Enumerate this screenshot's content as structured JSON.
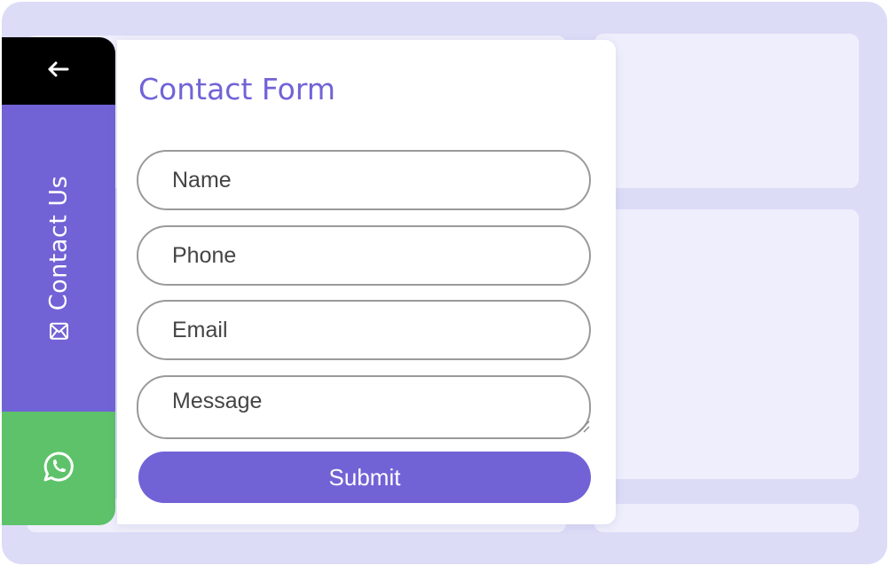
{
  "colors": {
    "accent": "#7163d6",
    "whatsapp": "#5ec26a",
    "back_bar": "#000000",
    "background": "#dcdcf7"
  },
  "sidetab": {
    "back_icon": "arrow-left-icon",
    "contact_label": "Contact Us",
    "contact_icon": "mail-icon",
    "whatsapp_icon": "whatsapp-icon"
  },
  "form": {
    "title": "Contact Form",
    "fields": {
      "name_placeholder": "Name",
      "phone_placeholder": "Phone",
      "email_placeholder": "Email",
      "message_placeholder": "Message"
    },
    "submit_label": "Submit"
  }
}
